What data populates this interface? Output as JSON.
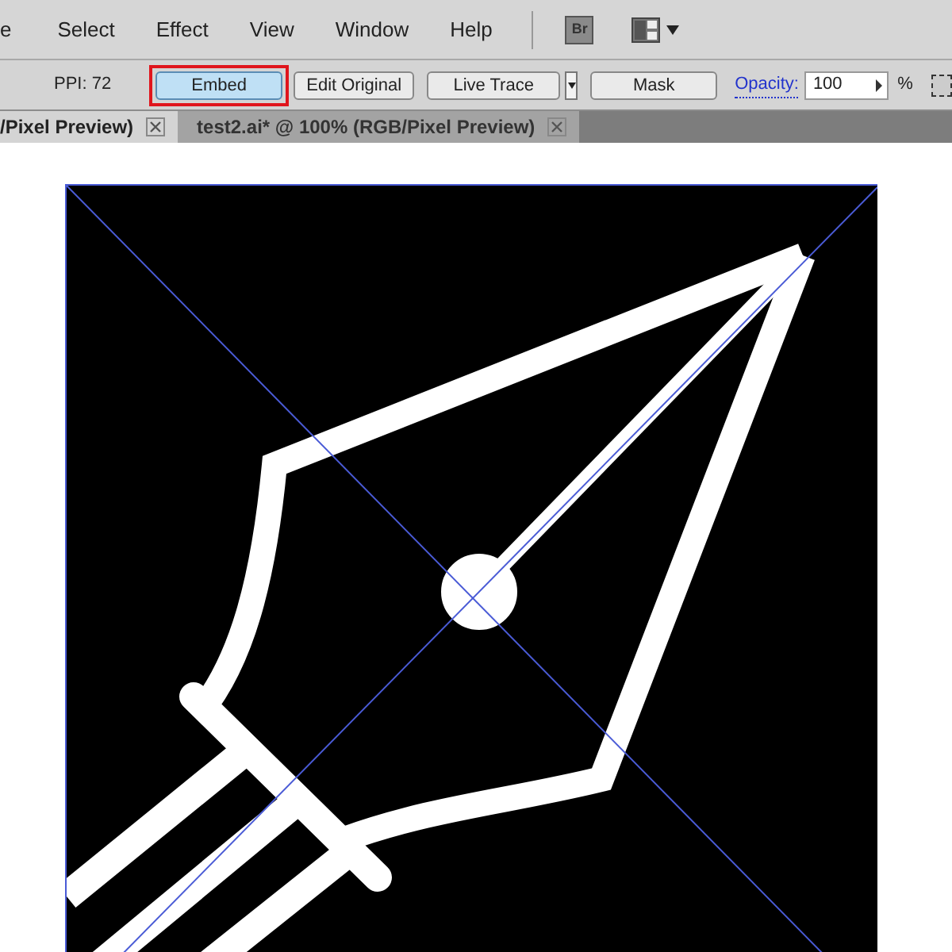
{
  "menu_bar": {
    "items": [
      "e",
      "Select",
      "Effect",
      "View",
      "Window",
      "Help"
    ],
    "bridge_button": "Br"
  },
  "control_bar": {
    "ppi": "PPI: 72",
    "buttons": [
      {
        "label": "Embed",
        "highlighted": true
      },
      {
        "label": "Edit Original",
        "highlighted": false
      },
      {
        "label": "Live Trace",
        "highlighted": false,
        "dropdown": true
      },
      {
        "label": "Mask",
        "highlighted": false
      }
    ],
    "opacity_label": "Opacity:",
    "opacity_value": "100",
    "opacity_unit": "%"
  },
  "tabs": [
    {
      "label": "/Pixel Preview)",
      "selected": false
    },
    {
      "label": "test2.ai* @ 100% (RGB/Pixel Preview)",
      "selected": true
    }
  ]
}
